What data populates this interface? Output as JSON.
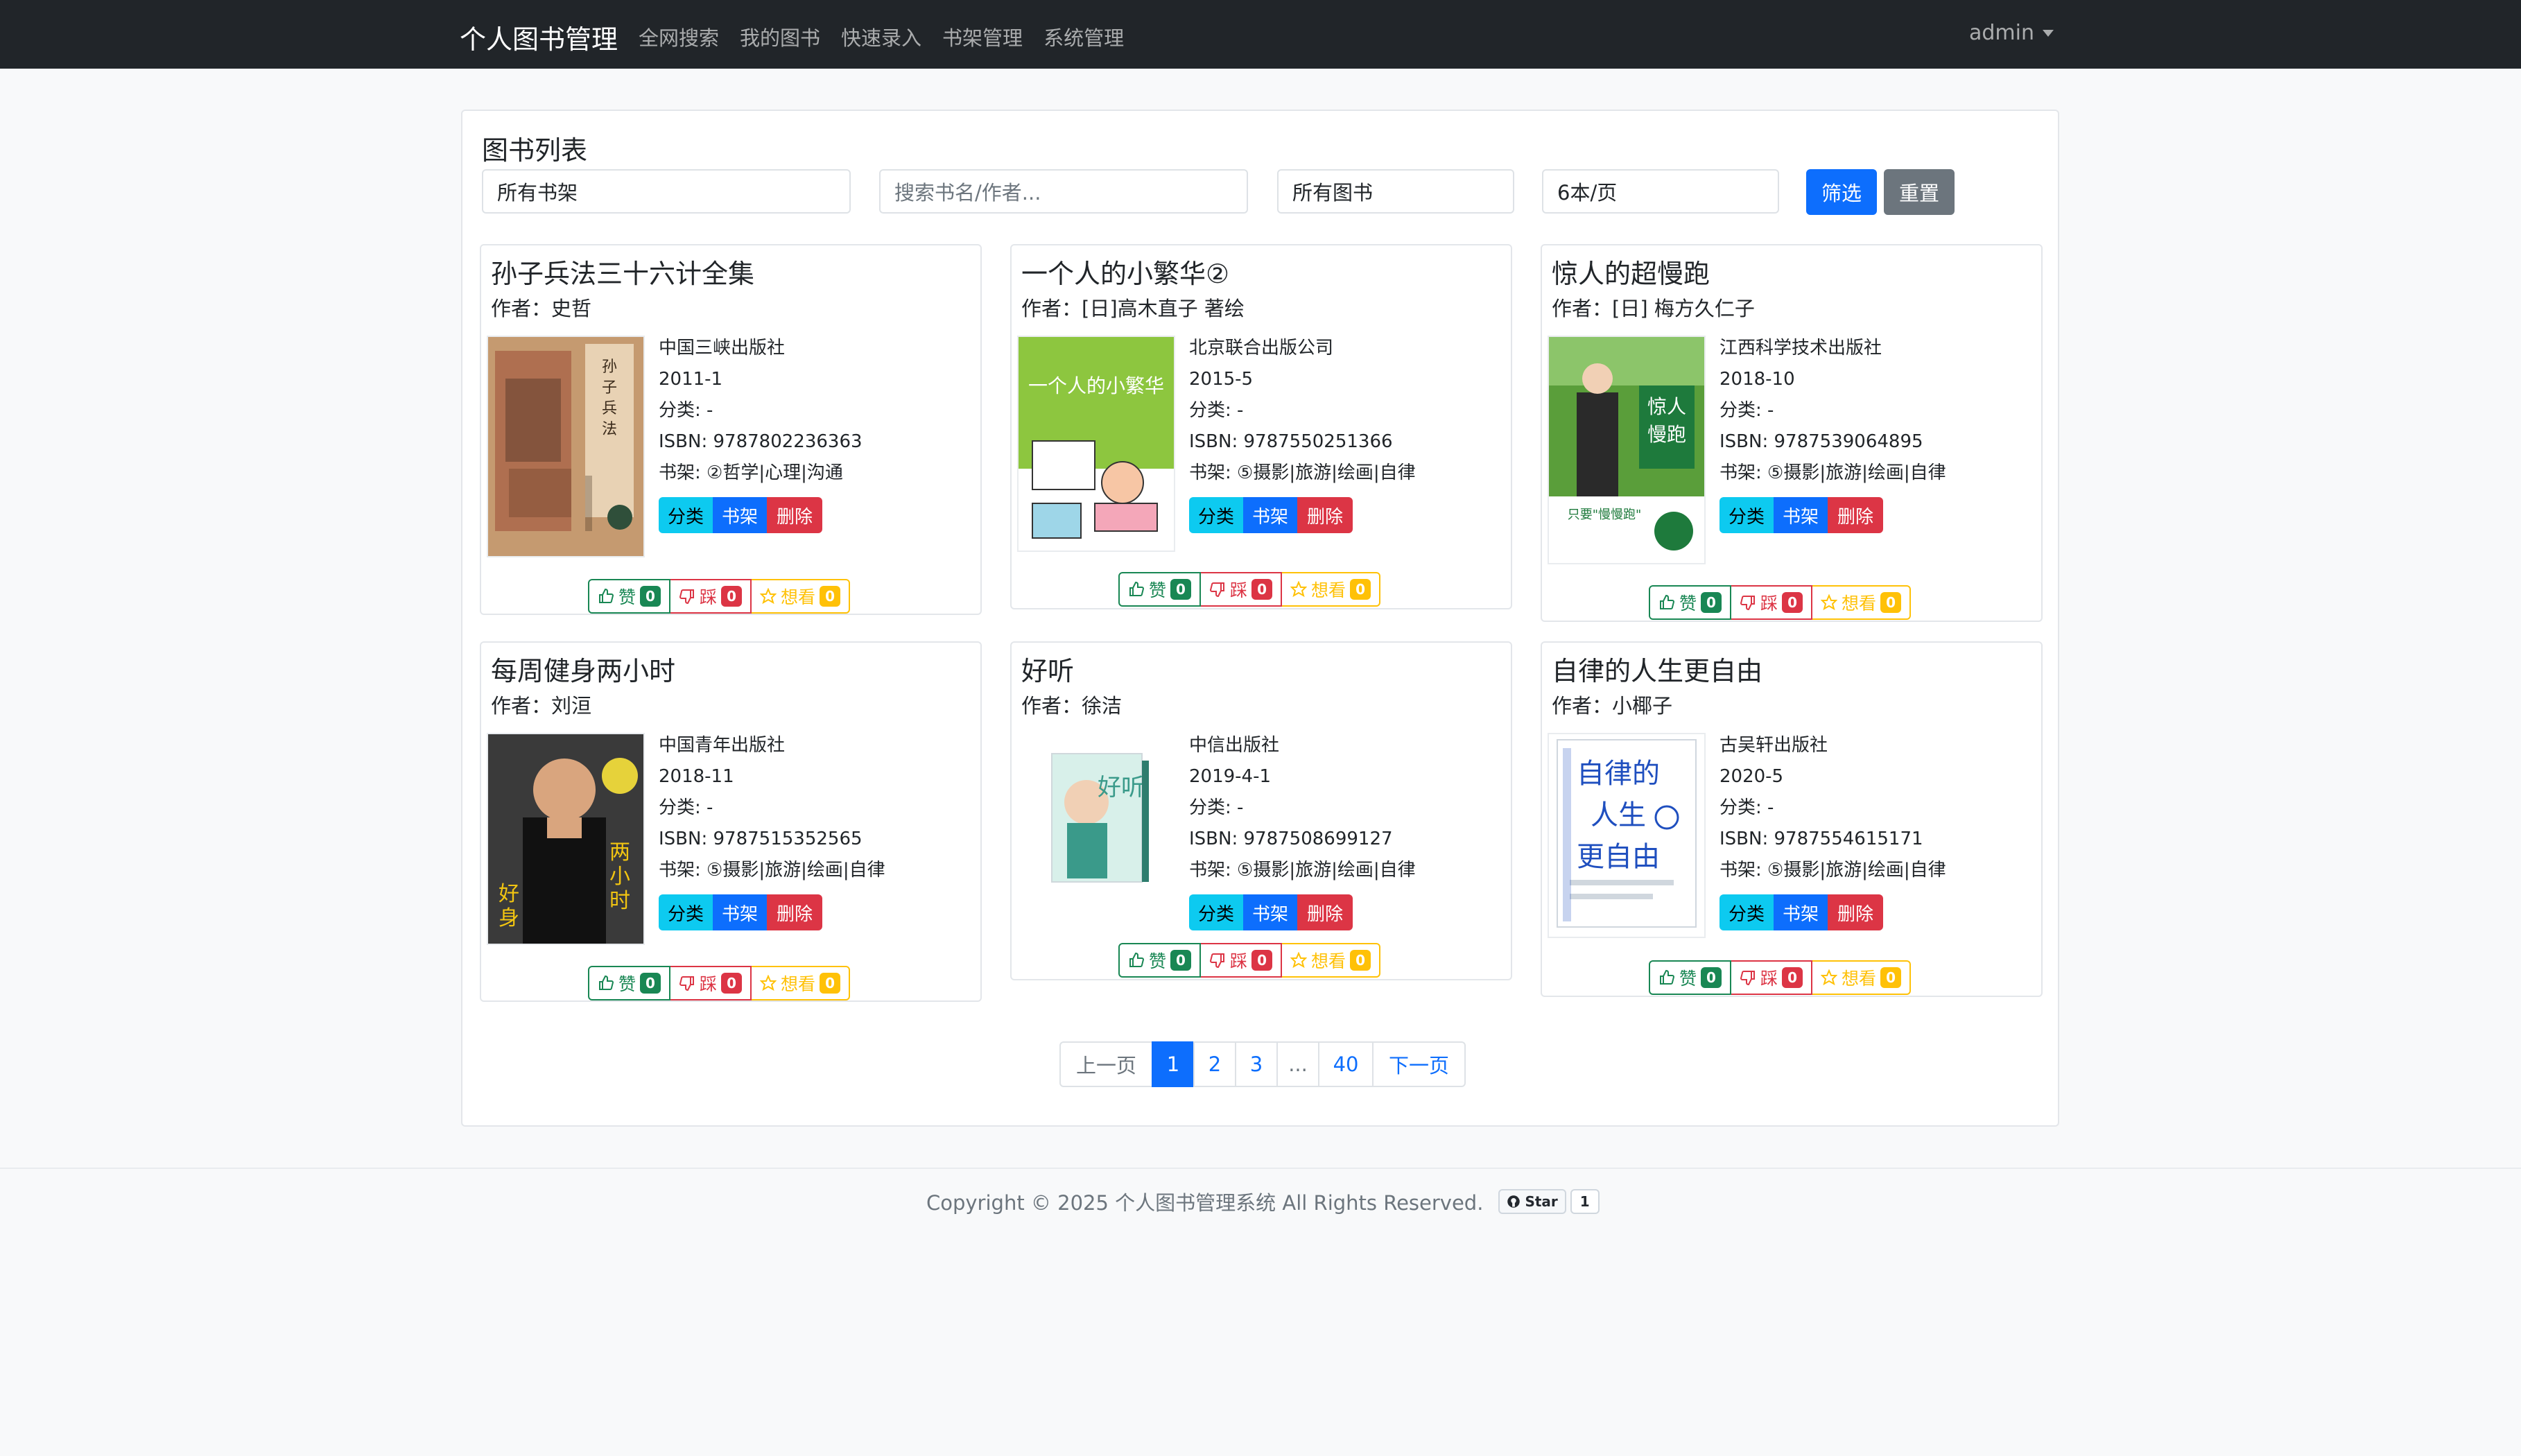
{
  "navbar": {
    "brand": "个人图书管理",
    "links": [
      "全网搜索",
      "我的图书",
      "快速录入",
      "书架管理",
      "系统管理"
    ],
    "user": "admin"
  },
  "list": {
    "title": "图书列表",
    "filters": {
      "shelf": "所有书架",
      "search_placeholder": "搜索书名/作者...",
      "scope": "所有图书",
      "per_page": "6本/页"
    },
    "filter_button": "筛选",
    "reset_button": "重置"
  },
  "book_labels": {
    "category_prefix": "分类: ",
    "isbn_prefix": "ISBN: ",
    "shelf_prefix": "书架: ",
    "btn_category": "分类",
    "btn_shelf": "书架",
    "btn_delete": "删除",
    "vote_up": "赞",
    "vote_down": "踩",
    "vote_want": "想看"
  },
  "books": [
    {
      "title": "孙子兵法三十六计全集",
      "author": "作者：史哲",
      "publisher": "中国三峡出版社",
      "date": "2011-1",
      "category": "分类: -",
      "isbn": "ISBN: 9787802236363",
      "shelf": "书架: ②哲学|心理|沟通",
      "likes": "0",
      "dislikes": "0",
      "wants": "0"
    },
    {
      "title": "一个人的小繁华②",
      "author": "作者：[日]高木直子 著绘",
      "publisher": "北京联合出版公司",
      "date": "2015-5",
      "category": "分类: -",
      "isbn": "ISBN: 9787550251366",
      "shelf": "书架: ⑤摄影|旅游|绘画|自律",
      "likes": "0",
      "dislikes": "0",
      "wants": "0"
    },
    {
      "title": "惊人的超慢跑",
      "author": "作者：[日] 梅方久仁子",
      "publisher": "江西科学技术出版社",
      "date": "2018-10",
      "category": "分类: -",
      "isbn": "ISBN: 9787539064895",
      "shelf": "书架: ⑤摄影|旅游|绘画|自律",
      "likes": "0",
      "dislikes": "0",
      "wants": "0"
    },
    {
      "title": "每周健身两小时",
      "author": "作者：刘洹",
      "publisher": "中国青年出版社",
      "date": "2018-11",
      "category": "分类: -",
      "isbn": "ISBN: 9787515352565",
      "shelf": "书架: ⑤摄影|旅游|绘画|自律",
      "likes": "0",
      "dislikes": "0",
      "wants": "0"
    },
    {
      "title": "好听",
      "author": "作者：徐洁",
      "publisher": "中信出版社",
      "date": "2019-4-1",
      "category": "分类: -",
      "isbn": "ISBN: 9787508699127",
      "shelf": "书架: ⑤摄影|旅游|绘画|自律",
      "likes": "0",
      "dislikes": "0",
      "wants": "0"
    },
    {
      "title": "自律的人生更自由",
      "author": "作者：小椰子",
      "publisher": "古吴轩出版社",
      "date": "2020-5",
      "category": "分类: -",
      "isbn": "ISBN: 9787554615171",
      "shelf": "书架: ⑤摄影|旅游|绘画|自律",
      "likes": "0",
      "dislikes": "0",
      "wants": "0"
    }
  ],
  "pagination": {
    "prev": "上一页",
    "pages": [
      "1",
      "2",
      "3",
      "...",
      "40"
    ],
    "current": "1",
    "next": "下一页"
  },
  "footer": {
    "copyright": "Copyright © 2025 个人图书管理系统 All Rights Reserved.",
    "github_star": "Star",
    "github_count": "1"
  },
  "colors": {
    "navbar": "#212529",
    "primary": "#0d6efd",
    "info": "#0dcaf0",
    "danger": "#dc3545",
    "success": "#198754",
    "warning": "#ffc107",
    "secondary": "#6c757d"
  },
  "icons": [
    "thumbs-up-icon",
    "thumbs-down-icon",
    "star-icon",
    "github-icon",
    "caret-down-icon"
  ]
}
